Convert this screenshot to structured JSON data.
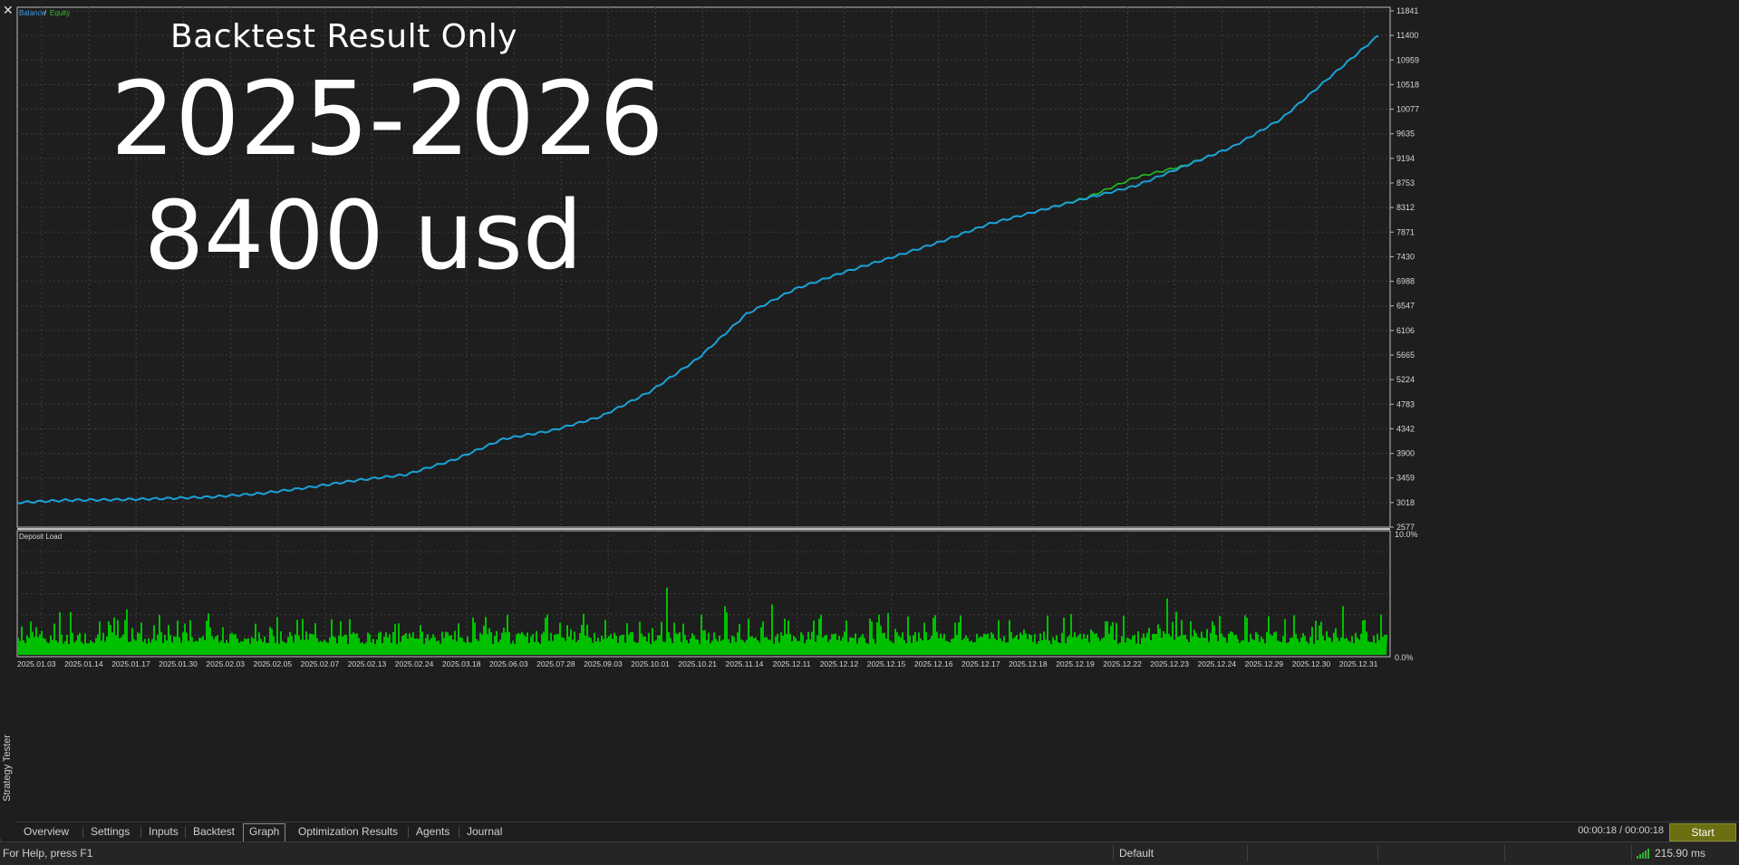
{
  "window": {
    "side_label": "Strategy Tester",
    "close_symbol": "✕"
  },
  "overlay": {
    "line1": "Backtest Result Only",
    "line2": "2025-2026",
    "line3": "8400 usd"
  },
  "main_chart": {
    "legend_balance": "Balance",
    "legend_sep": " / ",
    "legend_equity": "Equity",
    "balance_color": "#2f8fd6",
    "equity_color": "#22c022"
  },
  "load_chart": {
    "label": "Deposit Load",
    "y_top_label": "10.0%",
    "y_bottom_label": "0.0%",
    "bar_color": "#00c000"
  },
  "chart_data": [
    {
      "type": "line",
      "title": "",
      "series": [
        {
          "name": "Balance",
          "color": "#2f8fd6"
        },
        {
          "name": "Equity",
          "color": "#22c022"
        }
      ],
      "x": [
        "2025.01.03",
        "2025.01.14",
        "2025.01.17",
        "2025.01.30",
        "2025.02.03",
        "2025.02.05",
        "2025.02.07",
        "2025.02.13",
        "2025.02.24",
        "2025.03.18",
        "2025.06.03",
        "2025.07.28",
        "2025.09.03",
        "2025.10.01",
        "2025.10.21",
        "2025.11.14",
        "2025.12.11",
        "2025.12.12",
        "2025.12.15",
        "2025.12.16",
        "2025.12.17",
        "2025.12.18",
        "2025.12.19",
        "2025.12.22",
        "2025.12.23",
        "2025.12.24",
        "2025.12.29",
        "2025.12.30",
        "2025.12.31"
      ],
      "balance_values": [
        3018,
        3060,
        3070,
        3090,
        3120,
        3180,
        3290,
        3420,
        3520,
        3790,
        4160,
        4310,
        4560,
        5000,
        5600,
        6400,
        6850,
        7150,
        7420,
        7700,
        8020,
        8250,
        8480,
        8700,
        9050,
        9400,
        9900,
        10650,
        11400
      ],
      "equity_values": [
        3018,
        3060,
        3070,
        3090,
        3120,
        3180,
        3290,
        3420,
        3520,
        3790,
        4160,
        4310,
        4560,
        5000,
        5600,
        6400,
        6850,
        7150,
        7420,
        7700,
        8020,
        8250,
        8490,
        8850,
        9060,
        9400,
        9900,
        10650,
        11400
      ],
      "y_ticks": [
        2577,
        3018,
        3459,
        3900,
        4342,
        4783,
        5224,
        5665,
        6106,
        6547,
        6988,
        7430,
        7871,
        8312,
        8753,
        9194,
        9635,
        10077,
        10518,
        10959,
        11400,
        11841
      ],
      "ylim": [
        2577,
        11841
      ],
      "grid": true,
      "legend": "top-left"
    },
    {
      "type": "bar",
      "title": "Deposit Load",
      "ylim": [
        0,
        10
      ],
      "y_ticks": [
        "10.0%",
        "0.0%"
      ],
      "values_note": ""
    }
  ]
}
